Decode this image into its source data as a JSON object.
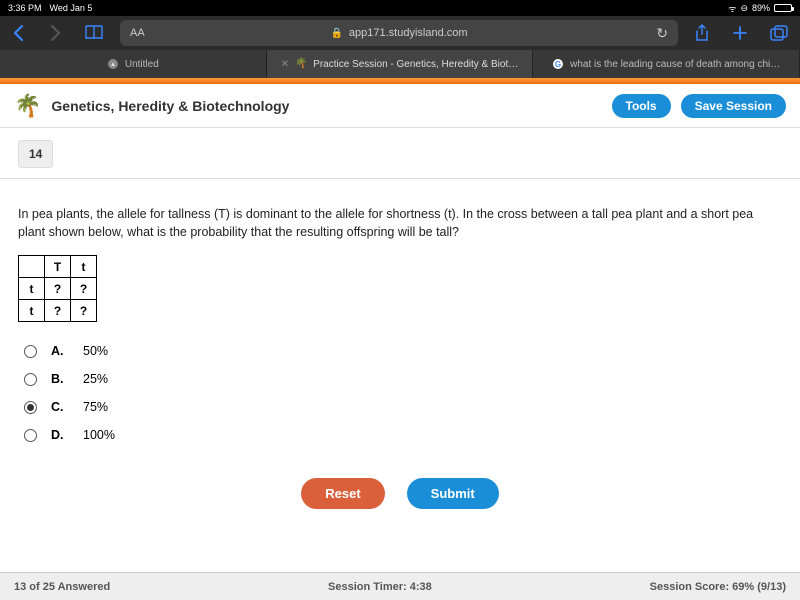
{
  "status": {
    "time": "3:36 PM",
    "date": "Wed Jan 5",
    "battery_pct": "89%"
  },
  "browser": {
    "url_host": "app171.studyisland.com",
    "aa": "AA",
    "tabs": [
      {
        "label": "Untitled"
      },
      {
        "label": "Practice Session - Genetics, Heredity & Biot…"
      },
      {
        "label": "what is the leading cause of death among chi…"
      }
    ]
  },
  "header": {
    "title": "Genetics, Heredity & Biotechnology",
    "tools_label": "Tools",
    "save_label": "Save Session"
  },
  "question": {
    "number": "14",
    "text": "In pea plants, the allele for tallness (T) is dominant to the allele for shortness (t). In the cross between a tall pea plant and a short pea plant shown below, what is the probability that the resulting offspring will be tall?",
    "punnett": {
      "col1": "T",
      "col2": "t",
      "row1": "t",
      "row2": "t",
      "cell": "?"
    },
    "answers": [
      {
        "label": "A.",
        "text": "50%",
        "selected": false
      },
      {
        "label": "B.",
        "text": "25%",
        "selected": false
      },
      {
        "label": "C.",
        "text": "75%",
        "selected": true
      },
      {
        "label": "D.",
        "text": "100%",
        "selected": false
      }
    ],
    "reset_label": "Reset",
    "submit_label": "Submit"
  },
  "footer": {
    "answered": "13 of 25 Answered",
    "timer": "Session Timer: 4:38",
    "score": "Session Score: 69% (9/13)"
  }
}
